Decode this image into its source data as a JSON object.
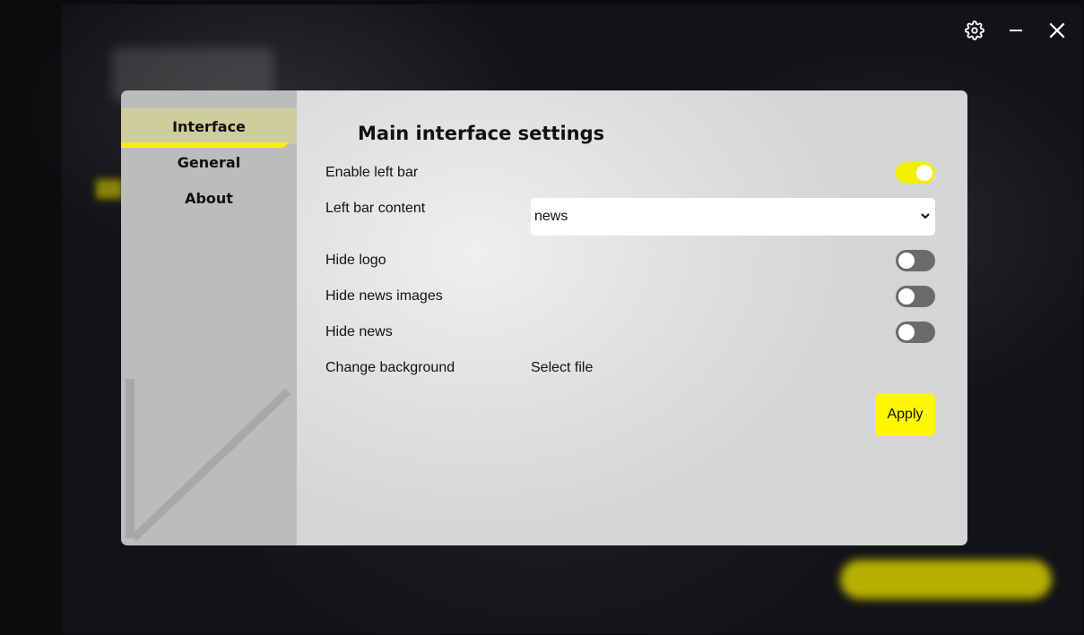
{
  "window": {
    "settings_icon": "gear-icon",
    "minimize_icon": "minimize-icon",
    "close_icon": "close-icon"
  },
  "sidebar": {
    "items": [
      {
        "label": "Interface",
        "active": true
      },
      {
        "label": "General",
        "active": false
      },
      {
        "label": "About",
        "active": false
      }
    ]
  },
  "main": {
    "title": "Main interface settings",
    "enable_left_bar": {
      "label": "Enable left bar",
      "value": true
    },
    "left_bar_content": {
      "label": "Left bar content",
      "selected": "news"
    },
    "hide_logo": {
      "label": "Hide logo",
      "value": false
    },
    "hide_news_images": {
      "label": "Hide news images",
      "value": false
    },
    "hide_news": {
      "label": "Hide news",
      "value": false
    },
    "change_background": {
      "label": "Change background",
      "action": "Select file"
    },
    "apply_label": "Apply"
  },
  "colors": {
    "accent": "#f4ee00",
    "toggle_off": "#6b6b6b",
    "sidebar_bg": "#bdbcbc",
    "active_nav_bg": "#cfcc9e"
  }
}
